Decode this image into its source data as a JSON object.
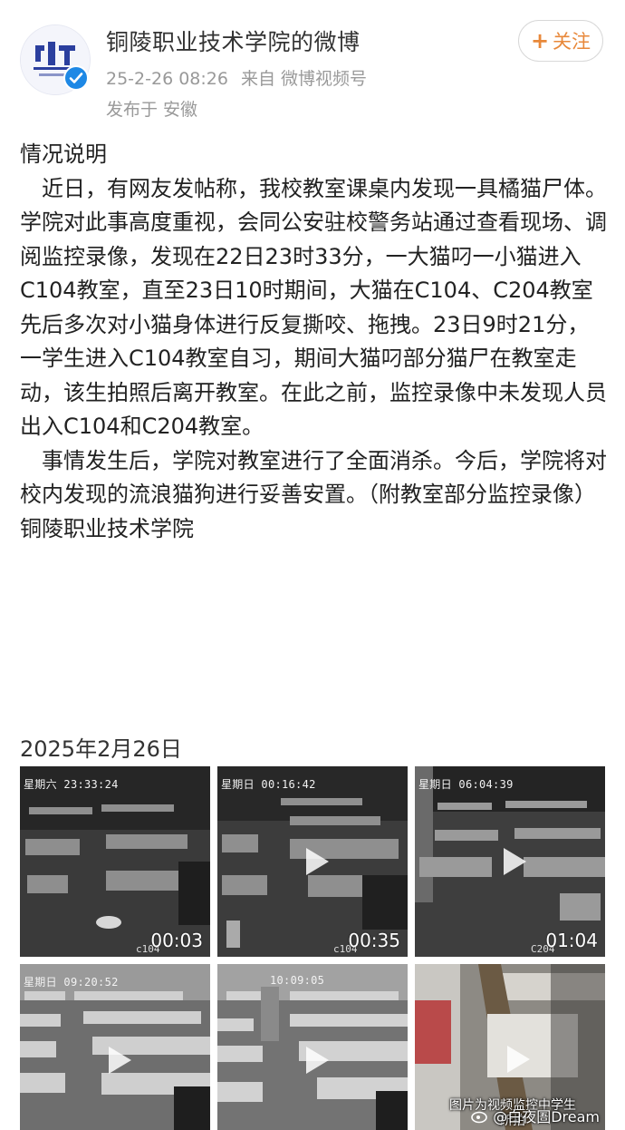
{
  "post": {
    "author": "铜陵职业技术学院的微博",
    "timestamp": "25-2-26 08:26",
    "from_label": "来自",
    "source": "微博视频号",
    "location": "发布于 安徽",
    "follow_label": "关注",
    "follow_plus": "+",
    "title": "情况说明",
    "paragraphs": [
      "近日，有网友发帖称，我校教室课桌内发现一具橘猫尸体。学院对此事高度重视，会同公安驻校警务站通过查看现场、调阅监控录像，发现在22日23时33分，一大猫叼一小猫进入C104教室，直至23日10时期间，大猫在C104、C204教室先后多次对小猫身体进行反复撕咬、拖拽。23日9时21分，一学生进入C104教室自习，期间大猫叼部分猫尸在教室走动，该生拍照后离开教室。在此之前，监控录像中未发现人员出入C104和C204教室。",
      "事情发生后，学院对教室进行了全面消杀。今后，学院将对校内发现的流浪猫狗进行妥善安置。（附教室部分监控录像）"
    ],
    "signature": "铜陵职业技术学院",
    "date": "2025年2月26日"
  },
  "media": [
    {
      "type": "video",
      "overlay": "星期六 23:33:24",
      "cam": "c104",
      "duration": "00:03"
    },
    {
      "type": "video",
      "overlay": "星期日 00:16:42",
      "cam": "c104",
      "duration": "00:35"
    },
    {
      "type": "video",
      "overlay": "星期日 06:04:39",
      "cam": "C204",
      "duration": "01:04"
    },
    {
      "type": "video",
      "overlay": "星期日 09:20:52",
      "cam": "",
      "duration": ""
    },
    {
      "type": "video",
      "overlay": "10:09:05",
      "cam": "",
      "duration": ""
    },
    {
      "type": "image",
      "caption": "图片为视频监控中学生所拍",
      "watermark": "@白夜圄Dream"
    }
  ],
  "colors": {
    "follow_accent": "#e8883a",
    "verified_badge": "#1e88e5",
    "meta_text": "#999999"
  },
  "icons": {
    "verified": "verified-badge-icon",
    "play": "play-icon",
    "weibo": "weibo-logo-icon"
  }
}
